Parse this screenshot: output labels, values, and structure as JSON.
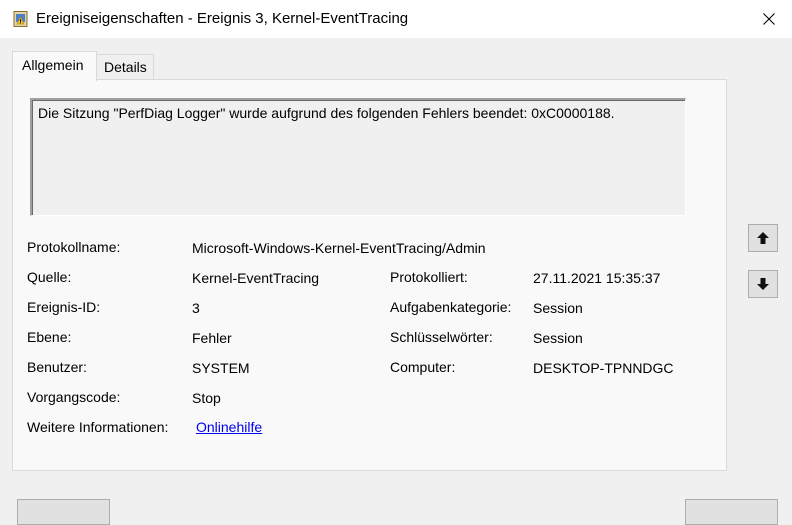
{
  "window": {
    "title": "Ereigniseigenschaften - Ereignis 3, Kernel-EventTracing",
    "icon": "event-viewer-icon",
    "close_icon": "close-icon"
  },
  "tabs": [
    {
      "label": "Allgemein",
      "active": true
    },
    {
      "label": "Details",
      "active": false
    }
  ],
  "message": "Die Sitzung \"PerfDiag Logger\" wurde aufgrund des folgenden Fehlers beendet: 0xC0000188.",
  "fields": {
    "protokollname": {
      "label": "Protokollname:",
      "value": "Microsoft-Windows-Kernel-EventTracing/Admin"
    },
    "quelle": {
      "label": "Quelle:",
      "value": "Kernel-EventTracing"
    },
    "protokolliert": {
      "label": "Protokolliert:",
      "value": "27.11.2021 15:35:37"
    },
    "ereignis_id": {
      "label": "Ereignis-ID:",
      "value": "3"
    },
    "aufgabenkategorie": {
      "label": "Aufgabenkategorie:",
      "value": "Session"
    },
    "ebene": {
      "label": "Ebene:",
      "value": "Fehler"
    },
    "schluesselwoerter": {
      "label": "Schlüsselwörter:",
      "value": "Session"
    },
    "benutzer": {
      "label": "Benutzer:",
      "value": "SYSTEM"
    },
    "computer": {
      "label": "Computer:",
      "value": "DESKTOP-TPNNDGC"
    },
    "vorgangscode": {
      "label": "Vorgangscode:",
      "value": "Stop"
    },
    "weitere_informationen": {
      "label": "Weitere Informationen:",
      "value": "Onlinehilfe"
    }
  },
  "nav_buttons": {
    "previous_icon": "arrow-up-icon",
    "next_icon": "arrow-down-icon"
  }
}
